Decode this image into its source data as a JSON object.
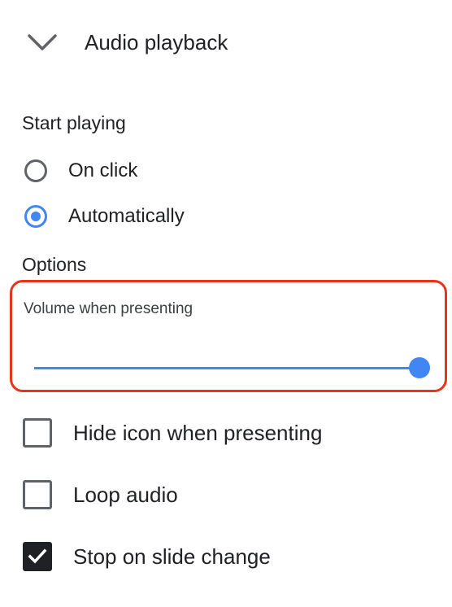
{
  "header": {
    "title": "Audio playback",
    "collapse_icon": "chevron-down-icon"
  },
  "start_playing": {
    "title": "Start playing",
    "options": [
      {
        "label": "On click",
        "selected": false
      },
      {
        "label": "Automatically",
        "selected": true
      }
    ]
  },
  "options": {
    "title": "Options",
    "volume": {
      "label": "Volume when presenting",
      "value_fraction": 1.0
    },
    "checkboxes": [
      {
        "label": "Hide icon when presenting",
        "checked": false
      },
      {
        "label": "Loop audio",
        "checked": false
      },
      {
        "label": "Stop on slide change",
        "checked": true
      }
    ]
  },
  "colors": {
    "accent": "#4285f4",
    "highlight": "#e8341c",
    "checked_box": "#202124"
  }
}
